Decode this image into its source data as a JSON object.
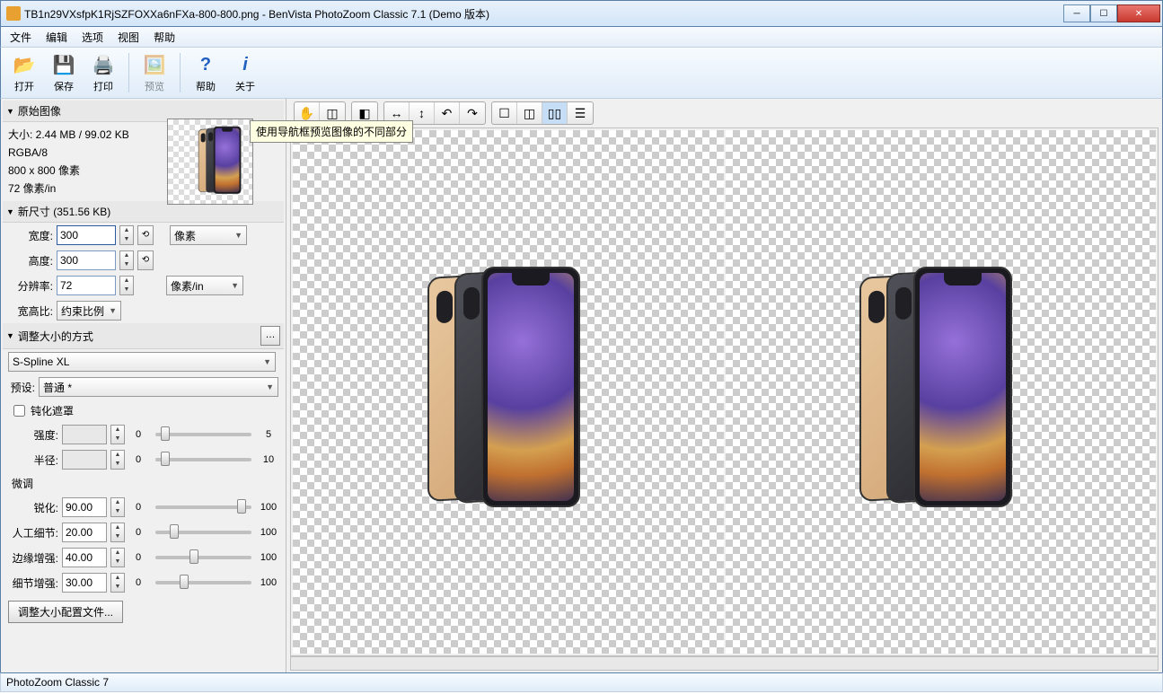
{
  "window": {
    "title": "TB1n29VXsfpK1RjSZFOXXa6nFXa-800-800.png - BenVista PhotoZoom Classic 7.1 (Demo 版本)"
  },
  "menu": {
    "file": "文件",
    "edit": "编辑",
    "options": "选项",
    "view": "视图",
    "help": "帮助"
  },
  "toolbar": {
    "open": "打开",
    "save": "保存",
    "print": "打印",
    "preview": "预览",
    "help": "帮助",
    "about": "关于"
  },
  "original": {
    "header": "原始图像",
    "size": "大小: 2.44 MB / 99.02 KB",
    "mode": "RGBA/8",
    "dims": "800 x 800 像素",
    "res": "72 像素/in"
  },
  "newsize": {
    "header": "新尺寸 (351.56 KB)",
    "width_label": "宽度:",
    "width_value": "300",
    "height_label": "高度:",
    "height_value": "300",
    "res_label": "分辨率:",
    "res_value": "72",
    "unit_pixel": "像素",
    "unit_res": "像素/in",
    "aspect_label": "宽高比:",
    "aspect_value": "约束比例"
  },
  "resize": {
    "header": "调整大小的方式",
    "method": "S-Spline XL",
    "preset_label": "预设:",
    "preset_value": "普通 *",
    "unsharp_label": "钝化遮罩",
    "strength_label": "强度:",
    "strength_value": "",
    "radius_label": "半径:",
    "radius_value": "",
    "finetune_label": "微调",
    "sharp_label": "锐化:",
    "sharp_value": "90.00",
    "detail_label": "人工细节:",
    "detail_value": "20.00",
    "edge_label": "边缘增强:",
    "edge_value": "40.00",
    "grain_label": "细节增强:",
    "grain_value": "30.00",
    "min": "0",
    "max100": "100",
    "max5": "5",
    "max10": "10",
    "profiles_btn": "调整大小配置文件..."
  },
  "tooltip": "使用导航框预览图像的不同部分",
  "status": {
    "text": "PhotoZoom Classic 7"
  }
}
